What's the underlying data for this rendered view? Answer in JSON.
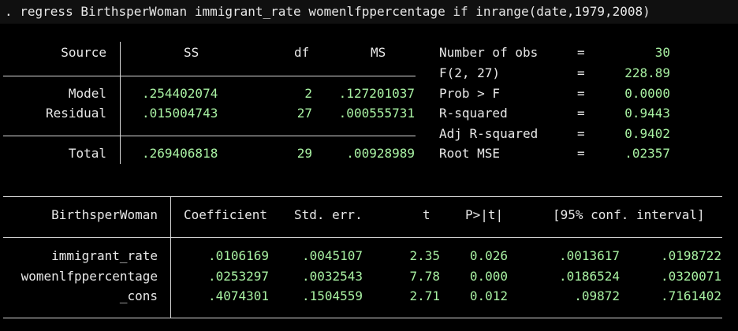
{
  "command": ". regress BirthsperWoman immigrant_rate womenlfppercentage if inrange(date,1979,2008)",
  "anova": {
    "headers": {
      "source": "Source",
      "ss": "SS",
      "df": "df",
      "ms": "MS"
    },
    "rows": [
      {
        "source": "Model",
        "ss": ".254402074",
        "df": "2",
        "ms": ".127201037"
      },
      {
        "source": "Residual",
        "ss": ".015004743",
        "df": "27",
        "ms": ".000555731"
      },
      {
        "source": "Total",
        "ss": ".269406818",
        "df": "29",
        "ms": ".00928989"
      }
    ]
  },
  "stats": [
    {
      "label": "Number of obs",
      "eq": "=",
      "value": "30"
    },
    {
      "label": "F(2, 27)",
      "eq": "=",
      "value": "228.89"
    },
    {
      "label": "Prob > F",
      "eq": "=",
      "value": "0.0000"
    },
    {
      "label": "R-squared",
      "eq": "=",
      "value": "0.9443"
    },
    {
      "label": "Adj R-squared",
      "eq": "=",
      "value": "0.9402"
    },
    {
      "label": "Root MSE",
      "eq": "=",
      "value": ".02357"
    }
  ],
  "coef": {
    "headers": {
      "var": "BirthsperWoman",
      "coef": "Coefficient",
      "se": "Std. err.",
      "t": "t",
      "p": "P>|t|",
      "ci": "[95% conf. interval]"
    },
    "rows": [
      {
        "var": "immigrant_rate",
        "coef": ".0106169",
        "se": ".0045107",
        "t": "2.35",
        "p": "0.026",
        "lo": ".0013617",
        "hi": ".0198722"
      },
      {
        "var": "womenlfppercentage",
        "coef": ".0253297",
        "se": ".0032543",
        "t": "7.78",
        "p": "0.000",
        "lo": ".0186524",
        "hi": ".0320071"
      },
      {
        "var": "_cons",
        "coef": ".4074301",
        "se": ".1504559",
        "t": "2.71",
        "p": "0.012",
        "lo": ".09872",
        "hi": ".7161402"
      }
    ]
  },
  "colors": {
    "background": "#000000",
    "text": "#e8e8e8",
    "value": "#a9f2a3"
  }
}
